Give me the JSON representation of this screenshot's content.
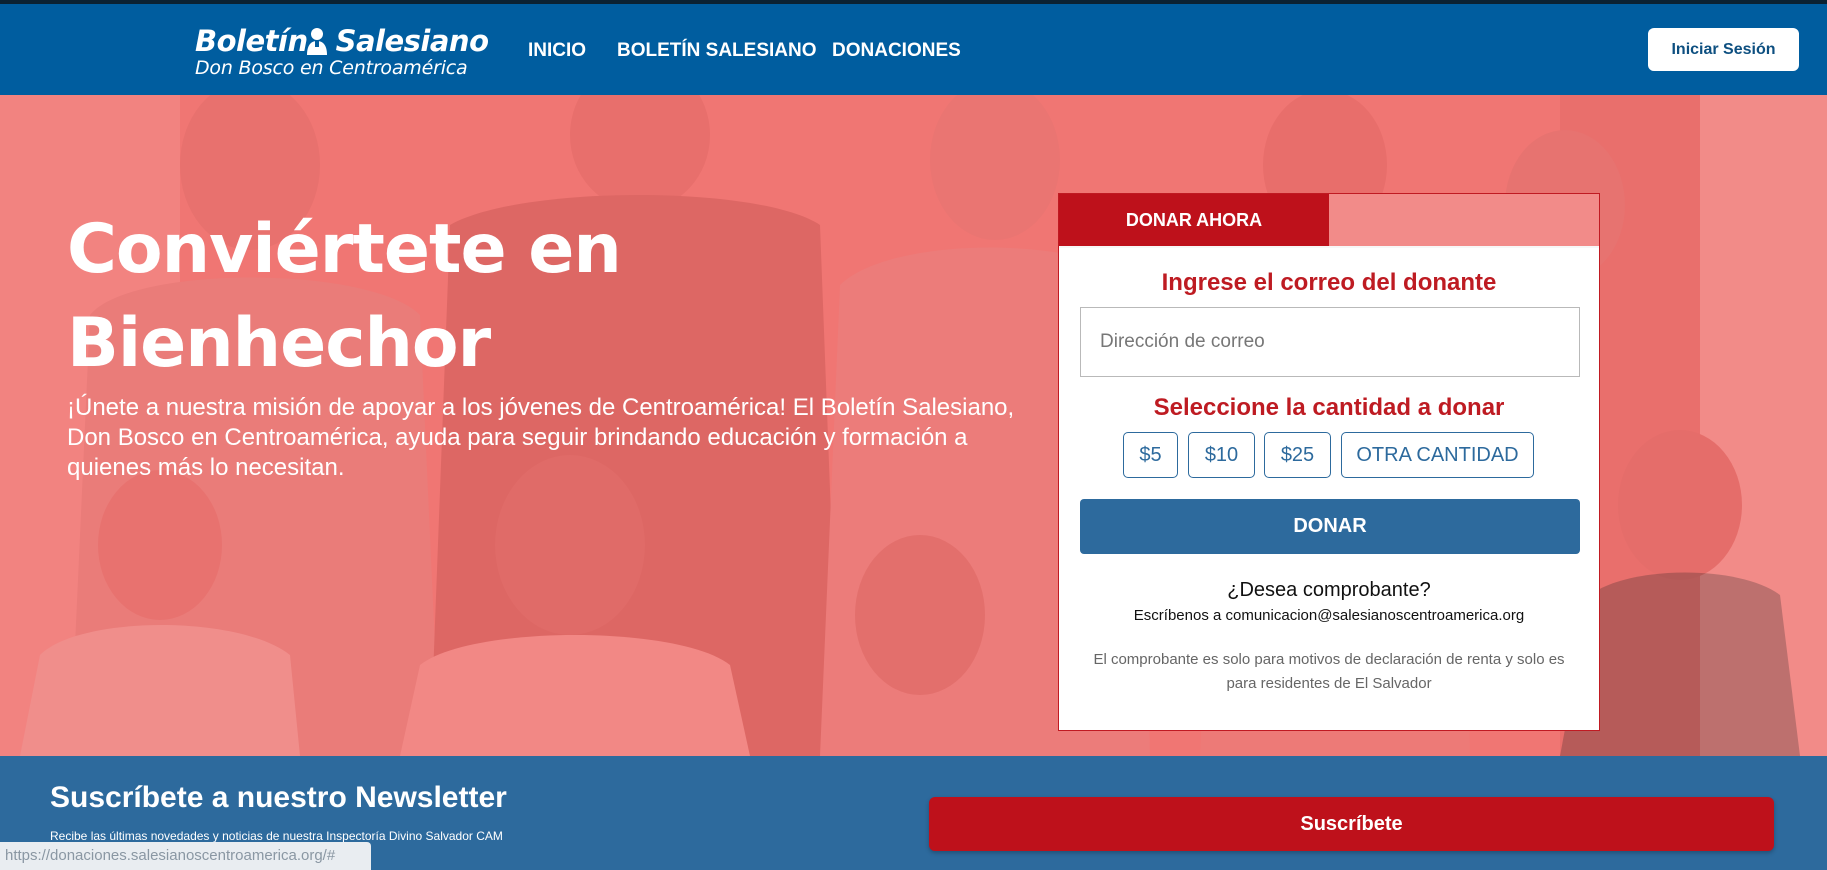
{
  "brand": {
    "title_part1": "Boletín",
    "title_part2": "Salesiano",
    "subtitle": "Don Bosco en Centroamérica"
  },
  "nav": {
    "items": [
      {
        "label": "INICIO"
      },
      {
        "label": "BOLETÍN SALESIANO"
      },
      {
        "label": "DONACIONES"
      }
    ],
    "login_label": "Iniciar Sesión"
  },
  "hero": {
    "title_line1": "Conviértete en",
    "title_line2": "Bienhechor",
    "text": "¡Únete a nuestra misión de apoyar a los jóvenes de Centroamérica! El Boletín Salesiano, Don Bosco en Centroamérica, ayuda para seguir brindando educación y formación a quienes más lo necesitan."
  },
  "donation": {
    "tab_label": "DONAR AHORA",
    "email_heading": "Ingrese el correo del donante",
    "email_value": "",
    "email_placeholder": "Dirección de correo",
    "amount_heading": "Seleccione la cantidad a donar",
    "amounts": [
      "$5",
      "$10",
      "$25",
      "OTRA CANTIDAD"
    ],
    "donate_label": "DONAR",
    "receipt_question": "¿Desea comprobante?",
    "receipt_write": "Escríbenos a comunicacion@salesianoscentroamerica.org",
    "note": "El comprobante es solo para motivos de declaración de renta y solo es para residentes de El Salvador"
  },
  "newsletter": {
    "title": "Suscríbete a nuestro Newsletter",
    "subtitle": "Recibe las últimas novedades y noticias de nuestra Inspectoría Divino Salvador CAM",
    "button_label": "Suscríbete"
  },
  "status_url": "https://donaciones.salesianoscentroamerica.org/#",
  "colors": {
    "header_blue": "#005d9f",
    "accent_red": "#be111b",
    "button_blue": "#2d6a9d",
    "hero_overlay": "#f07673"
  }
}
